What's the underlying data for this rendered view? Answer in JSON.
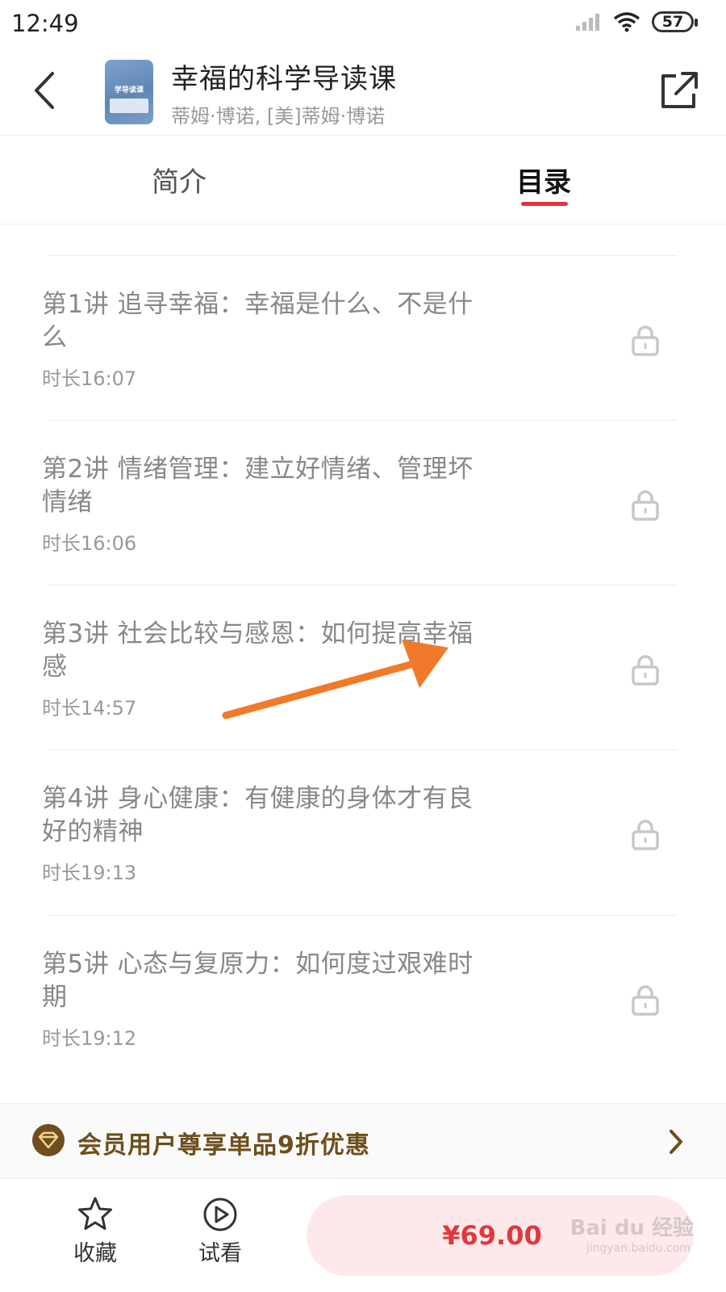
{
  "status_bar": {
    "time": "12:49",
    "battery": "57"
  },
  "header": {
    "title": "幸福的科学导读课",
    "author": "蒂姆·博诺, [美]蒂姆·博诺",
    "cover_text": "学导读课"
  },
  "tabs": [
    {
      "label": "简介",
      "active": false
    },
    {
      "label": "目录",
      "active": true
    }
  ],
  "lessons": [
    {
      "title": "第1讲 追寻幸福：幸福是什么、不是什么",
      "duration": "时长16:07",
      "locked": true
    },
    {
      "title": "第2讲 情绪管理：建立好情绪、管理坏情绪",
      "duration": "时长16:06",
      "locked": true
    },
    {
      "title": "第3讲 社会比较与感恩：如何提高幸福感",
      "duration": "时长14:57",
      "locked": true
    },
    {
      "title": "第4讲 身心健康：有健康的身体才有良好的精神",
      "duration": "时长19:13",
      "locked": true
    },
    {
      "title": "第5讲 心态与复原力：如何度过艰难时期",
      "duration": "时长19:12",
      "locked": true
    }
  ],
  "promo": {
    "text": "会员用户尊享单品9折优惠"
  },
  "bottom_bar": {
    "favorite_label": "收藏",
    "trial_label": "试看",
    "price": "¥69.00"
  },
  "watermark": {
    "main": "Bai du 经验",
    "sub": "jingyan.baidu.com"
  },
  "colors": {
    "accent_red": "#e5353b",
    "price_red": "#e0383e",
    "buy_bg": "#fde9e9",
    "promo_brown": "#6e4e1c",
    "annotation_arrow": "#f07a2a"
  },
  "icons": {
    "back": "chevron-left-icon",
    "share": "share-icon",
    "lock": "lock-icon",
    "promo": "vip-diamond-icon",
    "promo_arrow": "chevron-right-icon",
    "favorite": "star-icon",
    "trial": "play-circle-icon"
  }
}
